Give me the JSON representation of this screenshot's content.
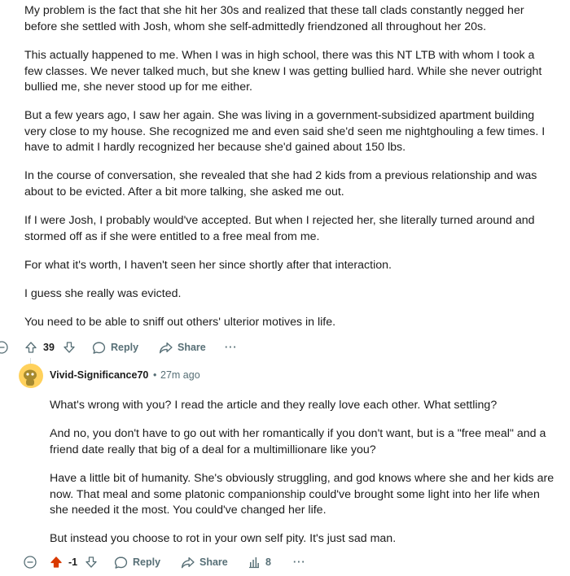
{
  "parent_comment": {
    "paragraphs": [
      "My problem is the fact that she hit her 30s and realized that these tall clads constantly negged her before she settled with Josh, whom she self-admittedly friendzoned all throughout her 20s.",
      "This actually happened to me. When I was in high school, there was this NT LTB with whom I took a few classes. We never talked much, but she knew I was getting bullied hard. While she never outright bullied me, she never stood up for me either.",
      "But a few years ago, I saw her again. She was living in a government-subsidized apartment building very close to my house. She recognized me and even said she'd seen me nightghouling a few times. I have to admit I hardly recognized her because she'd gained about 150 lbs.",
      "In the course of conversation, she revealed that she had 2 kids from a previous relationship and was about to be evicted. After a bit more talking, she asked me out.",
      "If I were Josh, I probably would've accepted. But when I rejected her, she literally turned around and stormed off as if she were entitled to a free meal from me.",
      "For what it's worth, I haven't seen her since shortly after that interaction.",
      "I guess she really was evicted.",
      "You need to be able to sniff out others' ulterior motives in life."
    ],
    "actions": {
      "vote_count": "39",
      "reply_label": "Reply",
      "share_label": "Share",
      "more_label": "···"
    }
  },
  "reply_comment": {
    "username": "Vivid-Significance70",
    "separator": "•",
    "time": "27m ago",
    "paragraphs": [
      "What's wrong with you? I read the article and they really love each other. What settling?",
      "And no, you don't have to go out with her romantically if you don't want, but is a \"free meal\" and a friend date really that big of a deal for a multimillionare like you?",
      "Have a little bit of humanity. She's obviously struggling, and god knows where she and her kids are now. That meal and some platonic companionship could've brought some light into her life when she needed it the most. You could've changed her life.",
      "But instead you choose to rot in your own self pity. It's just sad man."
    ],
    "actions": {
      "vote_count": "-1",
      "reply_label": "Reply",
      "share_label": "Share",
      "insights_count": "8",
      "more_label": "···"
    }
  },
  "colors": {
    "text": "#1c1c1c",
    "meta": "#576f76",
    "upvote_active": "#d93a00",
    "avatar_bg": "#ffe9a6"
  },
  "icons": [
    "collapse-icon",
    "upvote-icon",
    "downvote-icon",
    "reply-icon",
    "share-icon",
    "more-icon",
    "insights-icon",
    "avatar-icon"
  ]
}
